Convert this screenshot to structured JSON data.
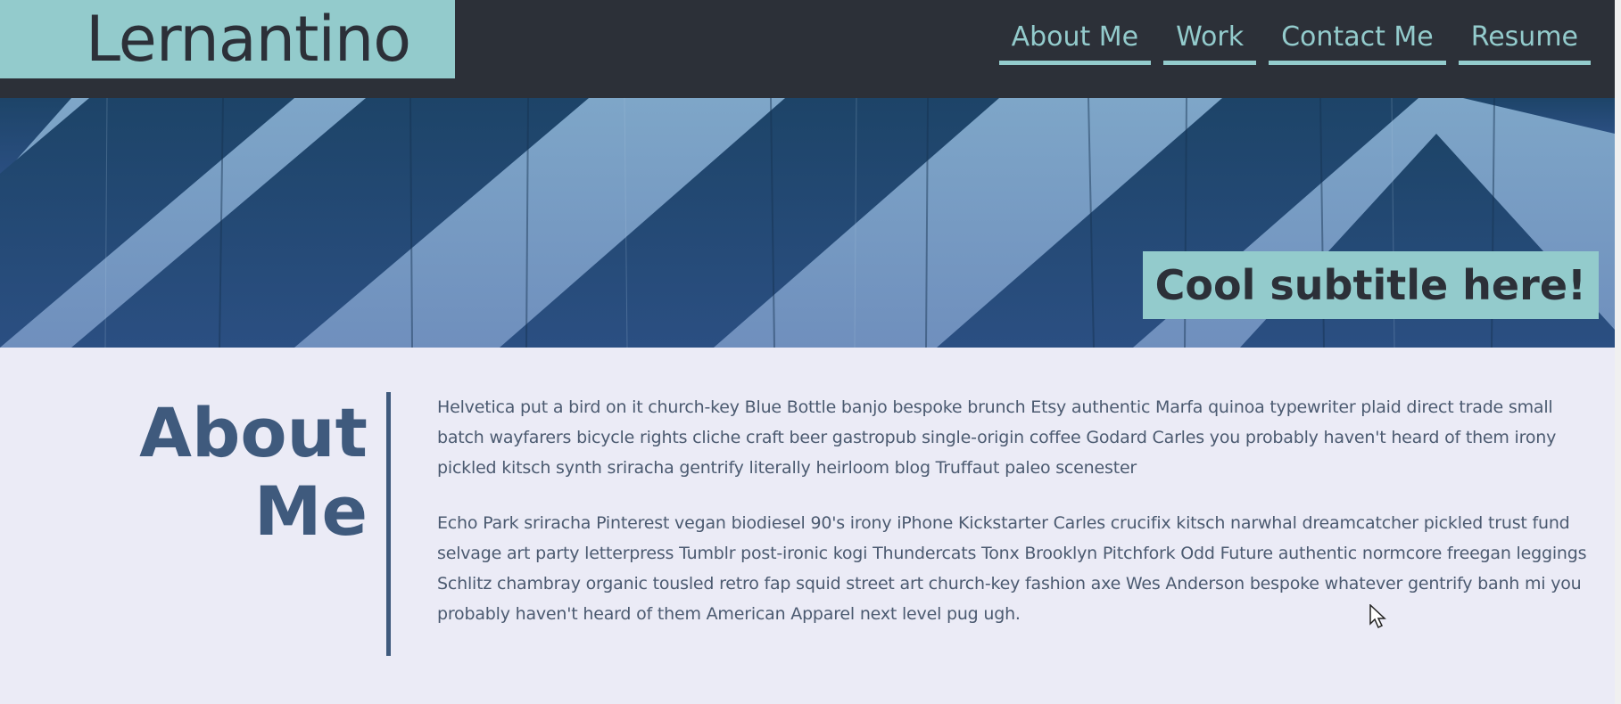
{
  "header": {
    "brand": "Lernantino",
    "nav": [
      {
        "label": "About Me"
      },
      {
        "label": "Work"
      },
      {
        "label": "Contact Me"
      },
      {
        "label": "Resume"
      }
    ]
  },
  "hero": {
    "subtitle": "Cool subtitle here!"
  },
  "about": {
    "title_line1": "About",
    "title_line2": "Me",
    "paragraphs": [
      "Helvetica put a bird on it church-key Blue Bottle banjo bespoke brunch Etsy authentic Marfa quinoa typewriter plaid direct trade small batch wayfarers bicycle rights cliche craft beer gastropub single-origin coffee Godard Carles you probably haven't heard of them irony pickled kitsch synth sriracha gentrify literally heirloom blog Truffaut paleo scenester",
      "Echo Park sriracha Pinterest vegan biodiesel 90's irony iPhone Kickstarter Carles crucifix kitsch narwhal dreamcatcher pickled trust fund selvage art party letterpress Tumblr post-ironic kogi Thundercats Tonx Brooklyn Pitchfork Odd Future authentic normcore freegan leggings Schlitz chambray organic tousled retro fap squid street art church-key fashion axe Wes Anderson bespoke whatever gentrify banh mi you probably haven't heard of them American Apparel next level pug ugh."
    ]
  },
  "colors": {
    "header_bg": "#2c3038",
    "accent": "#93cbcc",
    "page_bg": "#ebebf6",
    "heading": "#3f5a7d",
    "body_text": "#4b5a70"
  },
  "icons": {
    "cursor": "mouse-pointer-icon"
  }
}
